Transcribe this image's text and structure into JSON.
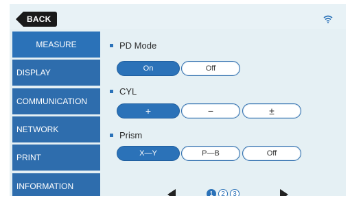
{
  "header": {
    "back_label": "BACK",
    "back_icon": "back-arrow-icon",
    "wifi_icon": "wifi-icon"
  },
  "sidebar": {
    "items": [
      {
        "label": "MEASURE",
        "active": true
      },
      {
        "label": "DISPLAY",
        "active": false
      },
      {
        "label": "COMMUNICATION",
        "active": false
      },
      {
        "label": "NETWORK",
        "active": false
      },
      {
        "label": "PRINT",
        "active": false
      },
      {
        "label": "INFORMATION",
        "active": false
      }
    ]
  },
  "main": {
    "pd_mode": {
      "title": "PD Mode",
      "options": [
        "On",
        "Off"
      ],
      "selected": "On"
    },
    "cyl": {
      "title": "CYL",
      "options": [
        "+",
        "−",
        "±"
      ],
      "selected": "+"
    },
    "prism": {
      "title": "Prism",
      "options": [
        "X—Y",
        "P—B",
        "Off"
      ],
      "selected": "X—Y"
    }
  },
  "pagination": {
    "pages": [
      "1",
      "2",
      "3"
    ],
    "current": "1",
    "prev_icon": "left-triangle-icon",
    "next_icon": "right-triangle-icon"
  },
  "colors": {
    "accent": "#2b72b8",
    "background": "#e5f0f4",
    "sidebar": "#2e6dad"
  }
}
